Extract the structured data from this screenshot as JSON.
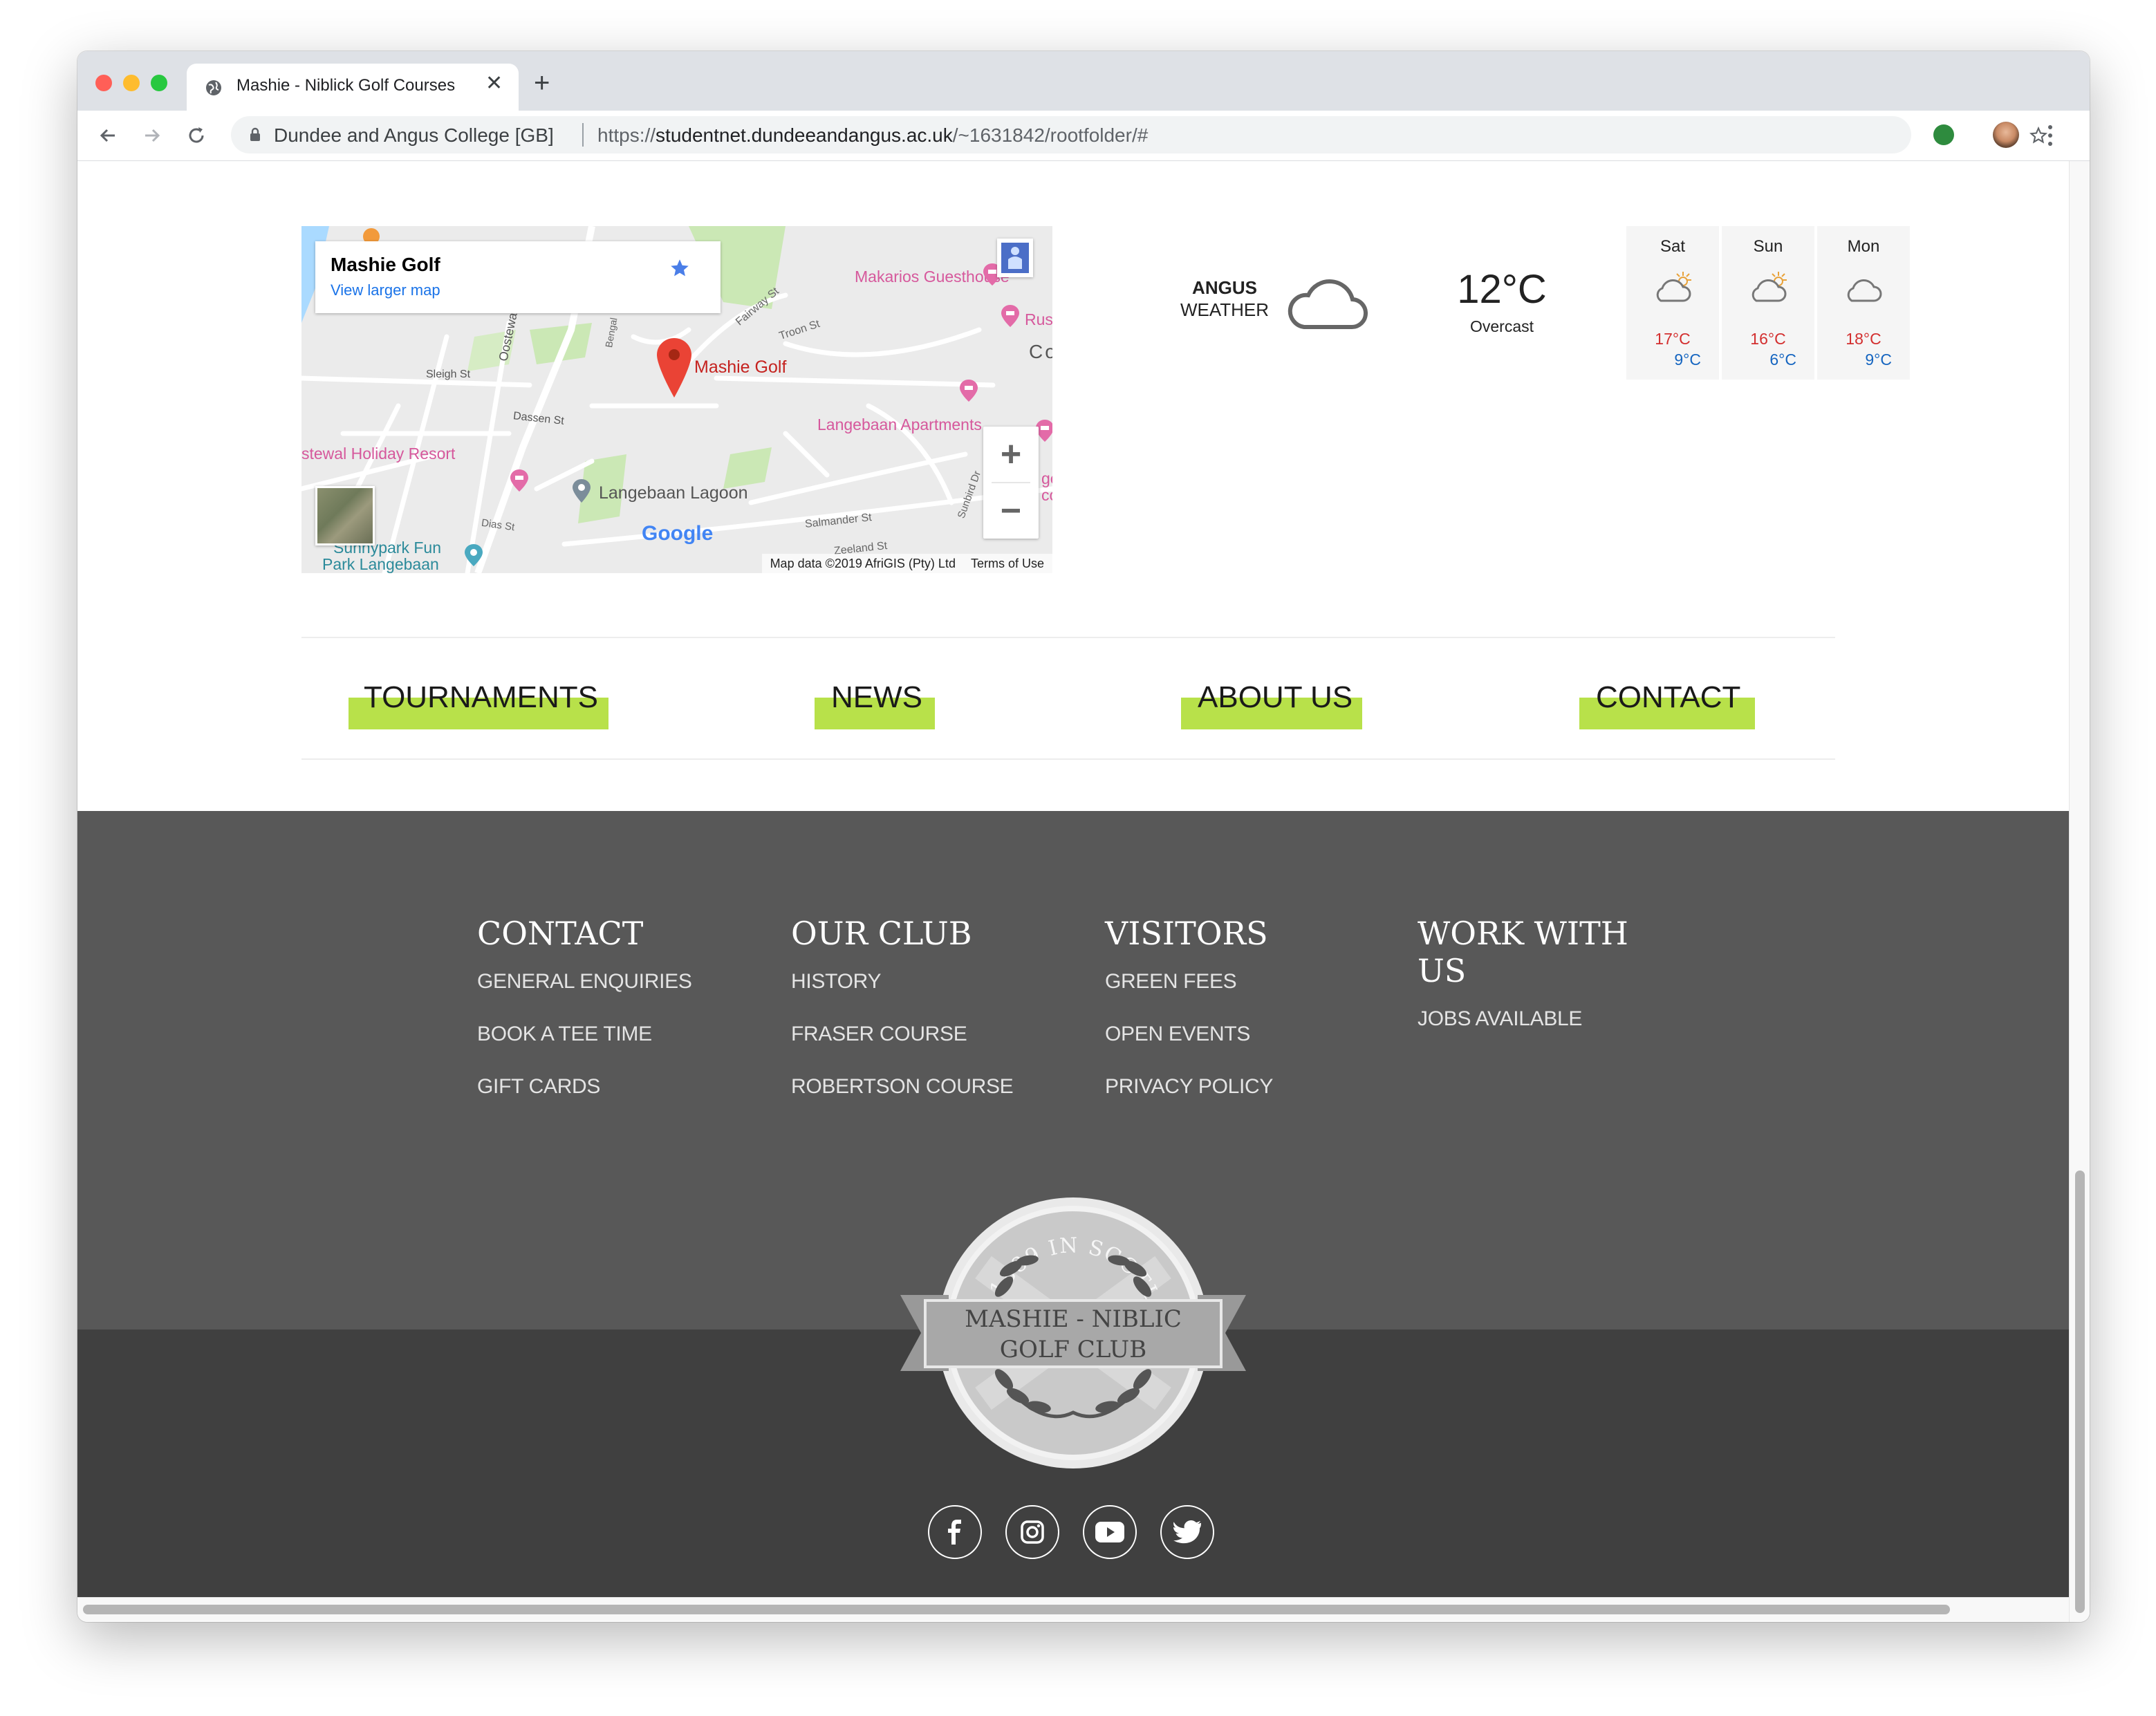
{
  "browser": {
    "tab_title": "Mashie - Niblick Golf Courses",
    "site_name": "Dundee and Angus College [GB]",
    "url_scheme": "https://",
    "url_host": "studentnet.dundeeandangus.ac.uk",
    "url_path": "/~1631842/rootfolder/#"
  },
  "map": {
    "card_title": "Mashie Golf",
    "card_link": "View larger map",
    "marker_label": "Mashie Golf",
    "labels": {
      "makarios": "Makarios Guesthouse",
      "rus": "Rus",
      "co": "Co",
      "fairway": "Fairway St",
      "troon": "Troon St",
      "oostewal": "Oostewal",
      "bengal": "Bengal",
      "sleigh": "Sleigh St",
      "dassen": "Dassen St",
      "langebaan_apts": "Langebaan Apartments",
      "holiday_resort": "stewal Holiday Resort",
      "lagoon": "Langebaan Lagoon",
      "sunbird": "Sunbird Dr",
      "salmander": "Salmander St",
      "dias": "Dias St",
      "zeeland": "Zeeland St",
      "sunnypark1": "Sunnypark Fun",
      "sunnypark2": "Park Langebaan",
      "ge": "ge",
      "co2": "co"
    },
    "google": "Google",
    "map_data": "Map data ©2019 AfriGIS (Pty) Ltd",
    "terms": "Terms of Use"
  },
  "weather": {
    "city": "ANGUS",
    "label": "WEATHER",
    "temp": "12°C",
    "condition": "Overcast",
    "forecast": [
      {
        "day": "Sat",
        "high": "17°C",
        "low": "9°C",
        "icon": "partly-cloudy-icon"
      },
      {
        "day": "Sun",
        "high": "16°C",
        "low": "6°C",
        "icon": "partly-cloudy-icon"
      },
      {
        "day": "Mon",
        "high": "18°C",
        "low": "9°C",
        "icon": "cloud-icon"
      }
    ]
  },
  "nav": {
    "tournaments": "TOURNAMENTS",
    "news": "NEWS",
    "about": "ABOUT US",
    "contact": "CONTACT"
  },
  "footer": {
    "columns": [
      {
        "heading": "CONTACT",
        "links": [
          "GENERAL ENQUIRIES",
          "BOOK A TEE TIME",
          "GIFT CARDS"
        ]
      },
      {
        "heading": "OUR CLUB",
        "links": [
          "HISTORY",
          "FRASER COURSE",
          "ROBERTSON COURSE"
        ]
      },
      {
        "heading": "VISITORS",
        "links": [
          "GREEN FEES",
          "OPEN EVENTS",
          "PRIVACY POLICY"
        ]
      },
      {
        "heading_line1": "WORK WITH",
        "heading_line2": "US",
        "links": [
          "JOBS AVAILABLE"
        ]
      }
    ],
    "logo": {
      "arc_text": "EST. 1889 IN SCOTLAND",
      "name_line1": "MASHIE - NIBLIC",
      "name_line2": "GOLF CLUB"
    },
    "social": [
      "facebook-icon",
      "instagram-icon",
      "youtube-icon",
      "twitter-icon"
    ]
  },
  "colors": {
    "accent": "#b8e14a",
    "footer_top": "#585858",
    "footer_bottom": "#404040"
  }
}
